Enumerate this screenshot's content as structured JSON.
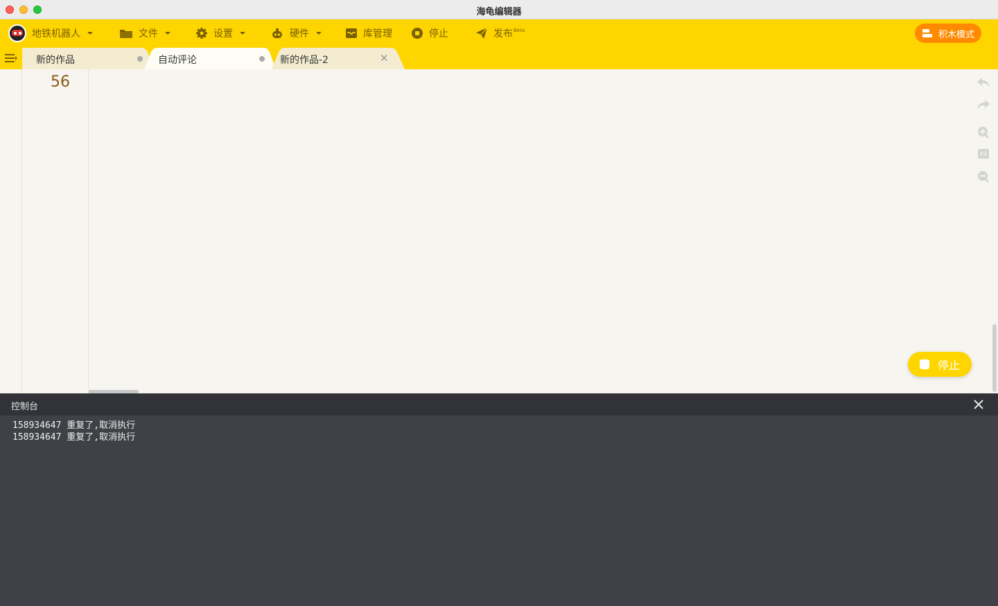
{
  "window": {
    "title": "海龟编辑器"
  },
  "toolbar": {
    "robot_label": "地铁机器人",
    "file_label": "文件",
    "settings_label": "设置",
    "hardware_label": "硬件",
    "library_label": "库管理",
    "stop_label": "停止",
    "publish_label": "发布",
    "publish_badge": "Beta",
    "block_mode_label": "积木模式"
  },
  "tabs": [
    {
      "label": "新的作品",
      "state": "modified"
    },
    {
      "label": "自动评论",
      "state": "modified",
      "active": true
    },
    {
      "label": "新的作品-2",
      "state": "closable"
    }
  ],
  "editor": {
    "line_numbers": [
      "56"
    ]
  },
  "floating": {
    "stop_label": "停止"
  },
  "console": {
    "title": "控制台",
    "lines": [
      "158934647 重复了,取消执行",
      "158934647 重复了,取消执行"
    ]
  },
  "colors": {
    "brand_yellow": "#ffd500",
    "block_mode_orange": "#ff8a00",
    "console_bg": "#3f4146"
  }
}
